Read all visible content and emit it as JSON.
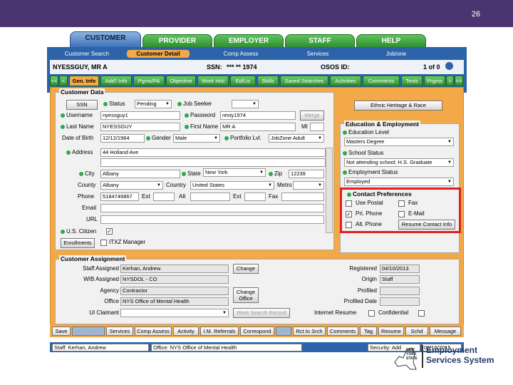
{
  "slide_number": "26",
  "top_tabs": [
    {
      "label": "CUSTOMER",
      "active": true
    },
    {
      "label": "PROVIDER"
    },
    {
      "label": "EMPLOYER"
    },
    {
      "label": "STAFF"
    },
    {
      "label": "HELP"
    }
  ],
  "sub_tabs": [
    "Customer Search",
    "Customer Detail",
    "Comp Assess",
    "Services",
    "Job/one"
  ],
  "header": {
    "name": "NYESSGUY, MR A",
    "ssn_label": "SSN:",
    "ssn_value": "*** ** 1974",
    "osos_label": "OSOS ID:",
    "page_of": "1 of 0"
  },
  "nav_arrows": {
    "first": "<<",
    "prev": "<",
    "next": ">",
    "last": ">>"
  },
  "green_tabs": [
    "Gen. Info",
    "Add'l Info",
    "Pgms/PA",
    "Objective",
    "Work Hist",
    "Ed/Lic",
    "Skills",
    "Saved Searches",
    "Activities",
    "Comments",
    "Tests",
    "Prgms"
  ],
  "customer_data": {
    "title": "Customer Data",
    "ssn_btn": "SSN",
    "status_label": "Status",
    "status_value": "Pending",
    "job_seeker_label": "Job Seeker",
    "username_label": "Username",
    "username_value": "nyessguy1",
    "password_label": "Password",
    "password_value": "resty1974",
    "merge_btn": "Merge",
    "last_name_label": "Last Name",
    "last_name_value": "NYESSGUY",
    "first_name_label": "First Name",
    "first_name_value": "MR A",
    "mi_label": "MI",
    "dob_label": "Date of Birth",
    "dob_value": "12/12/1964",
    "gender_label": "Gender",
    "gender_value": "Male",
    "portfolio_label": "Portfolio Lvl.",
    "portfolio_value": "JobZone Adult",
    "ethnic_btn": "Ethnic Heritage & Race",
    "address_label": "Address",
    "address_value": "44 Holland Ave",
    "city_label": "City",
    "city_value": "Albany",
    "state_label": "State",
    "state_value": "New York",
    "zip_label": "Zip",
    "zip_value": "12239",
    "county_label": "County",
    "county_value": "Albany",
    "country_label": "Country",
    "country_value": "United States",
    "metro_label": "Metro",
    "phone_label": "Phone",
    "phone_value": "5184749867",
    "ext_label": "Ext",
    "alt_label": "Alt",
    "ext2_label": "Ext",
    "fax_label": "Fax",
    "email_label": "Email",
    "url_label": "URL",
    "us_citizen_label": "U.S. Citizen",
    "enrollments_btn": "Enrollments",
    "ui_manager_label": "ITXZ Manager"
  },
  "education": {
    "title": "Education & Employment",
    "edu_level_label": "Education Level",
    "edu_level_value": "Masters Degree",
    "school_status_label": "School Status",
    "school_status_value": "Not attending school; H.S. Graduate",
    "emp_status_label": "Employment Status",
    "emp_status_value": "Employed"
  },
  "contact_prefs": {
    "title": "Contact Preferences",
    "items": [
      {
        "label": "Use Postal",
        "checked": false
      },
      {
        "label": "Fax",
        "checked": false
      },
      {
        "label": "Pri. Phone",
        "checked": true
      },
      {
        "label": "E-Mail",
        "checked": false
      },
      {
        "label": "Alt. Phone",
        "checked": false
      }
    ],
    "resume_btn": "Resume Contact Info"
  },
  "assignment": {
    "title": "Customer Assignment",
    "staff_label": "Staff Assigned",
    "staff_value": "Kerhan, Andrew",
    "change_btn": "Change",
    "wib_label": "WIB Assigned",
    "wib_value": "NYSDOL - CO",
    "agency_label": "Agency",
    "agency_value": "Contractor",
    "change_office_btn": "Change Office",
    "office_label": "Office",
    "office_value": "NYS Office of Mental Health",
    "ui_claimant_label": "UI Claimant",
    "work_search_btn": "Work Search Record",
    "registered_label": "Registered",
    "registered_value": "04/10/2013",
    "origin_label": "Origin",
    "origin_value": "Staff",
    "profiled_label": "Profiled",
    "profiled_date_label": "Profiled Date",
    "internet_resume_label": "Internet Resume",
    "confidential_label": "Confidential"
  },
  "bottom_buttons": [
    {
      "label": "Save"
    },
    {
      "label": "Save/Match",
      "disabled": true
    },
    {
      "label": "Services"
    },
    {
      "label": "Comp Assess"
    },
    {
      "label": "Activity"
    },
    {
      "label": "I.M. Referrals"
    },
    {
      "label": "Correspond"
    },
    {
      "label": "IVR",
      "disabled": true
    },
    {
      "label": "Rct to Srch"
    },
    {
      "label": "Comments"
    },
    {
      "label": "Tag"
    },
    {
      "label": "Resume"
    },
    {
      "label": "Schd"
    },
    {
      "label": "Message"
    }
  ],
  "status_bar": {
    "staff": "Staff: Kerhan, Andrew",
    "office": "Office: NYS Office of Mental Health",
    "security": "Security: Add",
    "date": "06/19/2015"
  },
  "logo": {
    "state_line1": "NEW",
    "state_line2": "YORK",
    "state_line3": "STATE",
    "brand_line1": "Employment",
    "brand_line2": "Services System"
  },
  "colors": {
    "header": "#4b3570",
    "blue": "#2d63a8",
    "orange": "#f3a948",
    "green": "#2f8f2f",
    "highlight": "#e02020"
  }
}
